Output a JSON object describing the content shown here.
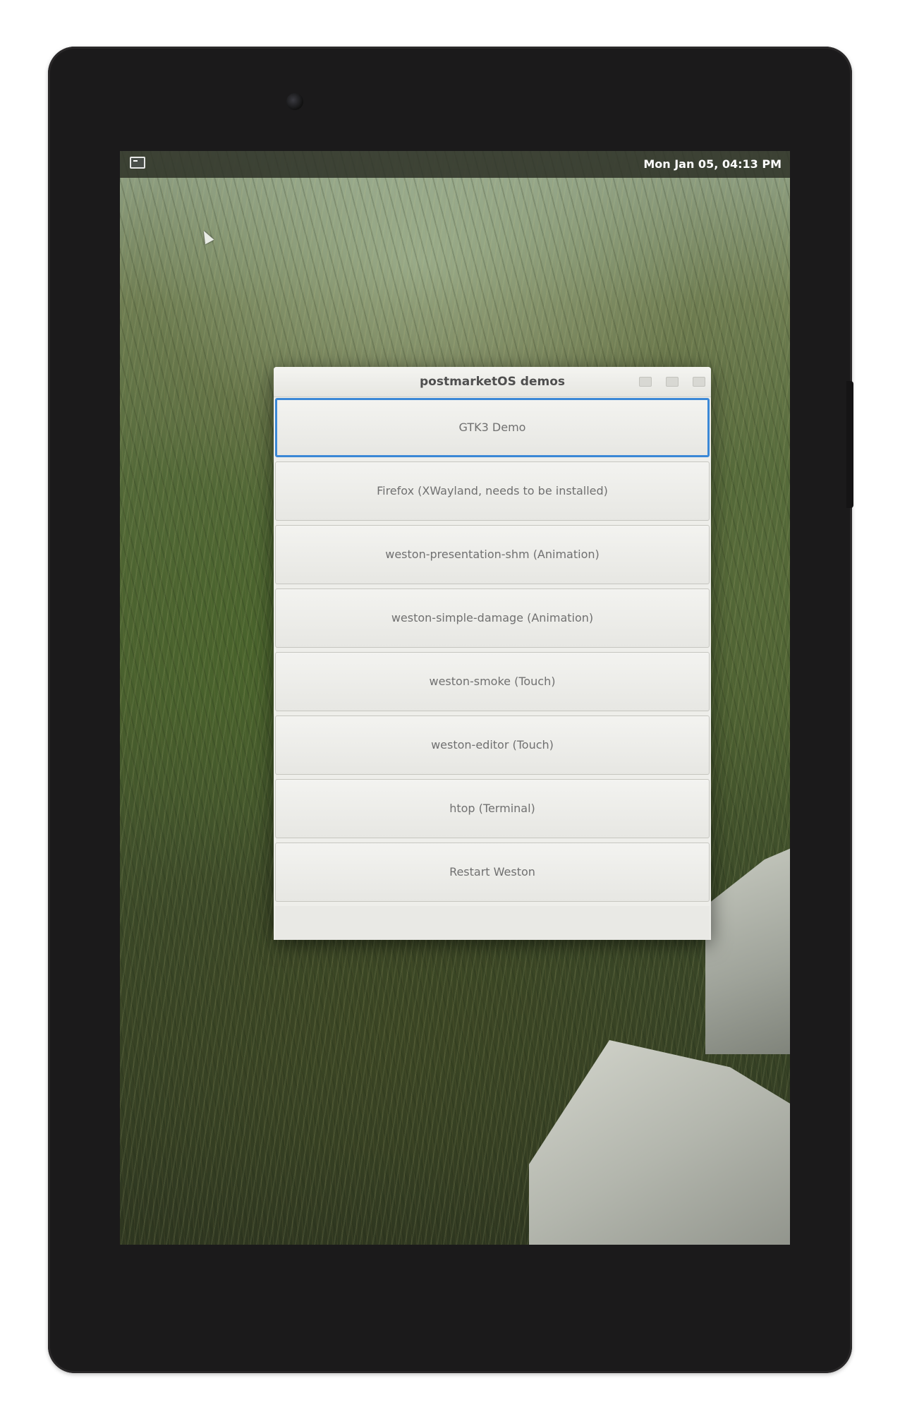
{
  "topbar": {
    "launcher_icon": "terminal-icon",
    "clock": "Mon Jan 05, 04:13 PM"
  },
  "window": {
    "title": "postmarketOS demos",
    "controls": [
      "minimize-icon",
      "maximize-icon",
      "close-icon"
    ],
    "buttons": [
      {
        "label": "GTK3 Demo"
      },
      {
        "label": "Firefox (XWayland, needs to be installed)"
      },
      {
        "label": "weston-presentation-shm (Animation)"
      },
      {
        "label": "weston-simple-damage (Animation)"
      },
      {
        "label": "weston-smoke (Touch)"
      },
      {
        "label": "weston-editor (Touch)"
      },
      {
        "label": "htop (Terminal)"
      },
      {
        "label": "Restart Weston"
      }
    ]
  },
  "colors": {
    "focus_ring": "#3b88d6",
    "topbar_bg": "#2d3026"
  }
}
